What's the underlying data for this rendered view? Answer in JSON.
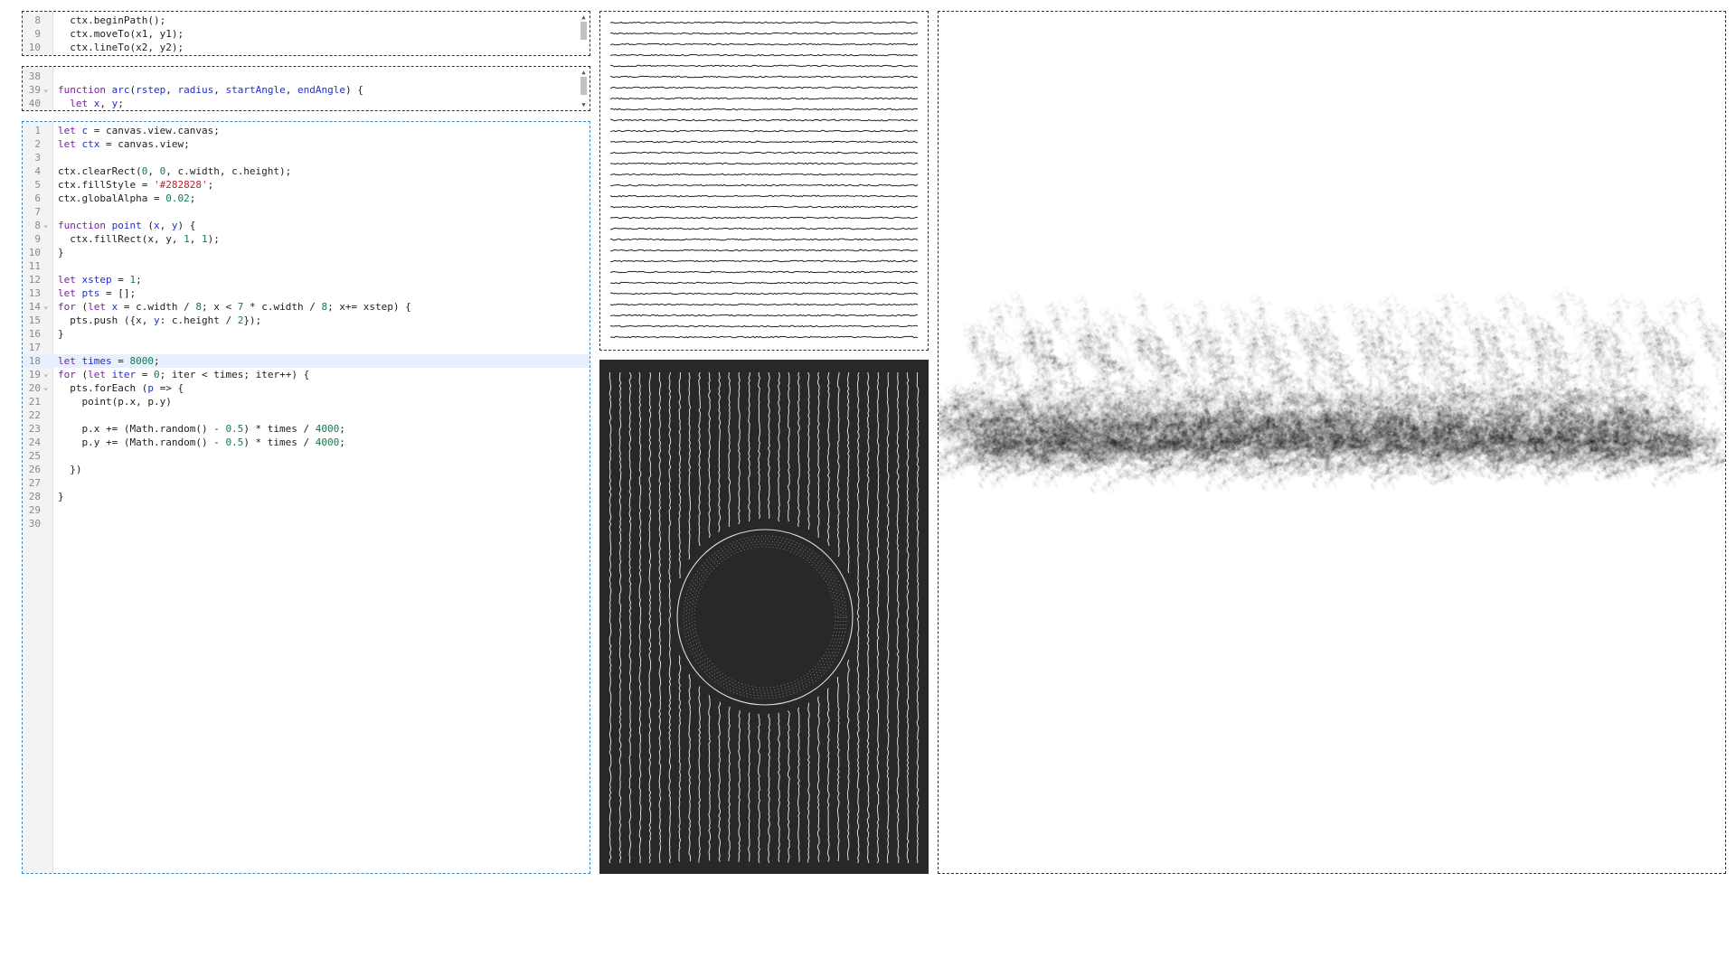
{
  "editor_small_1": {
    "lines": [
      {
        "n": "8",
        "fold": "",
        "tokens": [
          {
            "t": "  ctx.beginPath();"
          }
        ]
      },
      {
        "n": "9",
        "fold": "",
        "tokens": [
          {
            "t": "  ctx.moveTo(x1, y1);"
          }
        ]
      },
      {
        "n": "10",
        "fold": "",
        "tokens": [
          {
            "t": "  ctx.lineTo(x2, y2);"
          }
        ]
      }
    ]
  },
  "editor_small_2": {
    "lines": [
      {
        "n": "38",
        "fold": "",
        "tokens": [
          {
            "t": ""
          }
        ]
      },
      {
        "n": "39",
        "fold": "⌄",
        "tokens": [
          {
            "t": "function ",
            "c": "kw"
          },
          {
            "t": "arc",
            "c": "df"
          },
          {
            "t": "("
          },
          {
            "t": "rstep",
            "c": "df"
          },
          {
            "t": ", "
          },
          {
            "t": "radius",
            "c": "df"
          },
          {
            "t": ", "
          },
          {
            "t": "startAngle",
            "c": "df"
          },
          {
            "t": ", "
          },
          {
            "t": "endAngle",
            "c": "df"
          },
          {
            "t": ") {"
          }
        ]
      },
      {
        "n": "40",
        "fold": "",
        "tokens": [
          {
            "t": "  "
          },
          {
            "t": "let ",
            "c": "kw"
          },
          {
            "t": "x",
            "c": "df"
          },
          {
            "t": ", "
          },
          {
            "t": "y",
            "c": "df"
          },
          {
            "t": ";"
          }
        ]
      }
    ]
  },
  "editor_main": {
    "active_line": "18",
    "lines": [
      {
        "n": "1",
        "fold": "",
        "tokens": [
          {
            "t": "let ",
            "c": "kw"
          },
          {
            "t": "c",
            "c": "df"
          },
          {
            "t": " = canvas.view.canvas;"
          }
        ]
      },
      {
        "n": "2",
        "fold": "",
        "tokens": [
          {
            "t": "let ",
            "c": "kw"
          },
          {
            "t": "ctx",
            "c": "df"
          },
          {
            "t": " = canvas.view;"
          }
        ]
      },
      {
        "n": "3",
        "fold": "",
        "tokens": [
          {
            "t": ""
          }
        ]
      },
      {
        "n": "4",
        "fold": "",
        "tokens": [
          {
            "t": "ctx.clearRect("
          },
          {
            "t": "0",
            "c": "num"
          },
          {
            "t": ", "
          },
          {
            "t": "0",
            "c": "num"
          },
          {
            "t": ", c.width, c.height);"
          }
        ]
      },
      {
        "n": "5",
        "fold": "",
        "tokens": [
          {
            "t": "ctx.fillStyle = "
          },
          {
            "t": "'#282828'",
            "c": "str"
          },
          {
            "t": ";"
          }
        ]
      },
      {
        "n": "6",
        "fold": "",
        "tokens": [
          {
            "t": "ctx.globalAlpha = "
          },
          {
            "t": "0.02",
            "c": "num"
          },
          {
            "t": ";"
          }
        ]
      },
      {
        "n": "7",
        "fold": "",
        "tokens": [
          {
            "t": ""
          }
        ]
      },
      {
        "n": "8",
        "fold": "⌄",
        "tokens": [
          {
            "t": "function ",
            "c": "kw"
          },
          {
            "t": "point",
            "c": "df"
          },
          {
            "t": " ("
          },
          {
            "t": "x",
            "c": "df"
          },
          {
            "t": ", "
          },
          {
            "t": "y",
            "c": "df"
          },
          {
            "t": ") {"
          }
        ]
      },
      {
        "n": "9",
        "fold": "",
        "tokens": [
          {
            "t": "  ctx.fillRect(x, y, "
          },
          {
            "t": "1",
            "c": "num"
          },
          {
            "t": ", "
          },
          {
            "t": "1",
            "c": "num"
          },
          {
            "t": ");"
          }
        ]
      },
      {
        "n": "10",
        "fold": "",
        "tokens": [
          {
            "t": "}"
          }
        ]
      },
      {
        "n": "11",
        "fold": "",
        "tokens": [
          {
            "t": ""
          }
        ]
      },
      {
        "n": "12",
        "fold": "",
        "tokens": [
          {
            "t": "let ",
            "c": "kw"
          },
          {
            "t": "xstep",
            "c": "df"
          },
          {
            "t": " = "
          },
          {
            "t": "1",
            "c": "num"
          },
          {
            "t": ";"
          }
        ]
      },
      {
        "n": "13",
        "fold": "",
        "tokens": [
          {
            "t": "let ",
            "c": "kw"
          },
          {
            "t": "pts",
            "c": "df"
          },
          {
            "t": " = [];"
          }
        ]
      },
      {
        "n": "14",
        "fold": "⌄",
        "tokens": [
          {
            "t": "for",
            "c": "kw"
          },
          {
            "t": " ("
          },
          {
            "t": "let ",
            "c": "kw"
          },
          {
            "t": "x",
            "c": "df"
          },
          {
            "t": " = c.width / "
          },
          {
            "t": "8",
            "c": "num"
          },
          {
            "t": "; x < "
          },
          {
            "t": "7",
            "c": "num"
          },
          {
            "t": " * c.width / "
          },
          {
            "t": "8",
            "c": "num"
          },
          {
            "t": "; x+= xstep) {"
          }
        ]
      },
      {
        "n": "15",
        "fold": "",
        "tokens": [
          {
            "t": "  pts.push ({x, "
          },
          {
            "t": "y",
            "c": "df"
          },
          {
            "t": ": c.height / "
          },
          {
            "t": "2",
            "c": "num"
          },
          {
            "t": "});"
          }
        ]
      },
      {
        "n": "16",
        "fold": "",
        "tokens": [
          {
            "t": "}"
          }
        ]
      },
      {
        "n": "17",
        "fold": "",
        "tokens": [
          {
            "t": ""
          }
        ]
      },
      {
        "n": "18",
        "fold": "",
        "tokens": [
          {
            "t": "let ",
            "c": "kw"
          },
          {
            "t": "times",
            "c": "df"
          },
          {
            "t": " = "
          },
          {
            "t": "8000",
            "c": "num"
          },
          {
            "t": ";"
          }
        ]
      },
      {
        "n": "19",
        "fold": "⌄",
        "tokens": [
          {
            "t": "for",
            "c": "kw"
          },
          {
            "t": " ("
          },
          {
            "t": "let ",
            "c": "kw"
          },
          {
            "t": "iter",
            "c": "df"
          },
          {
            "t": " = "
          },
          {
            "t": "0",
            "c": "num"
          },
          {
            "t": "; iter < times; iter++) {"
          }
        ]
      },
      {
        "n": "20",
        "fold": "⌄",
        "tokens": [
          {
            "t": "  pts.forEach ("
          },
          {
            "t": "p",
            "c": "df"
          },
          {
            "t": " => {"
          }
        ]
      },
      {
        "n": "21",
        "fold": "",
        "tokens": [
          {
            "t": "    point(p.x, p.y)"
          }
        ]
      },
      {
        "n": "22",
        "fold": "",
        "tokens": [
          {
            "t": ""
          }
        ]
      },
      {
        "n": "23",
        "fold": "",
        "tokens": [
          {
            "t": "    p.x += (Math.random() - "
          },
          {
            "t": "0.5",
            "c": "num"
          },
          {
            "t": ") * times / "
          },
          {
            "t": "4000",
            "c": "num"
          },
          {
            "t": ";"
          }
        ]
      },
      {
        "n": "24",
        "fold": "",
        "tokens": [
          {
            "t": "    p.y += (Math.random() - "
          },
          {
            "t": "0.5",
            "c": "num"
          },
          {
            "t": ") * times / "
          },
          {
            "t": "4000",
            "c": "num"
          },
          {
            "t": ";"
          }
        ]
      },
      {
        "n": "25",
        "fold": "",
        "tokens": [
          {
            "t": ""
          }
        ]
      },
      {
        "n": "26",
        "fold": "",
        "tokens": [
          {
            "t": "  })"
          }
        ]
      },
      {
        "n": "27",
        "fold": "",
        "tokens": [
          {
            "t": ""
          }
        ]
      },
      {
        "n": "28",
        "fold": "",
        "tokens": [
          {
            "t": "}"
          }
        ]
      },
      {
        "n": "29",
        "fold": "",
        "tokens": [
          {
            "t": ""
          }
        ]
      },
      {
        "n": "30",
        "fold": "",
        "tokens": [
          {
            "t": ""
          }
        ]
      }
    ]
  },
  "artwork": {
    "wavy_lines_bg": "#ffffff",
    "wavy_lines_stroke": "#222222",
    "vertical_lines_bg": "#282828",
    "vertical_lines_stroke": "#dddddd",
    "scatter_fill": "#282828"
  }
}
